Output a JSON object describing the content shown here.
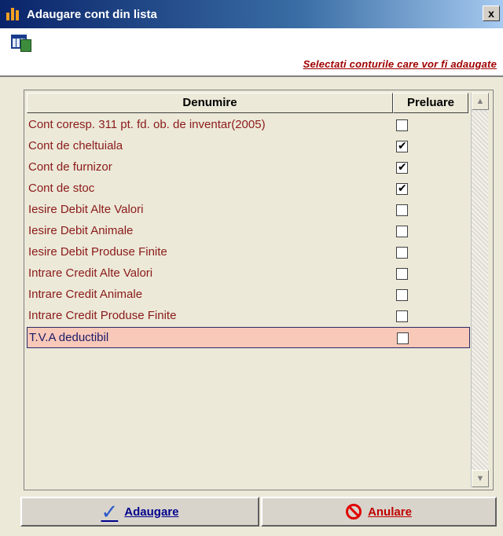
{
  "window": {
    "title": "Adaugare cont din lista",
    "close_label": "x"
  },
  "header": {
    "hint": "Selectati conturile care vor fi adaugate"
  },
  "grid": {
    "columns": {
      "name": "Denumire",
      "take": "Preluare"
    },
    "rows": [
      {
        "name": "Cont coresp. 311 pt. fd. ob. de inventar(2005)",
        "checked": false
      },
      {
        "name": "Cont de cheltuiala",
        "checked": true
      },
      {
        "name": "Cont de furnizor",
        "checked": true
      },
      {
        "name": "Cont de stoc",
        "checked": true
      },
      {
        "name": "Iesire Debit Alte Valori",
        "checked": false
      },
      {
        "name": "Iesire Debit Animale",
        "checked": false
      },
      {
        "name": "Iesire Debit Produse Finite",
        "checked": false
      },
      {
        "name": "Intrare Credit Alte Valori",
        "checked": false
      },
      {
        "name": "Intrare Credit Animale",
        "checked": false
      },
      {
        "name": "Intrare Credit Produse Finite",
        "checked": false
      },
      {
        "name": "T.V.A deductibil",
        "checked": false,
        "selected": true
      }
    ]
  },
  "buttons": {
    "add_label": "Adaugare",
    "cancel_label": "Anulare"
  }
}
